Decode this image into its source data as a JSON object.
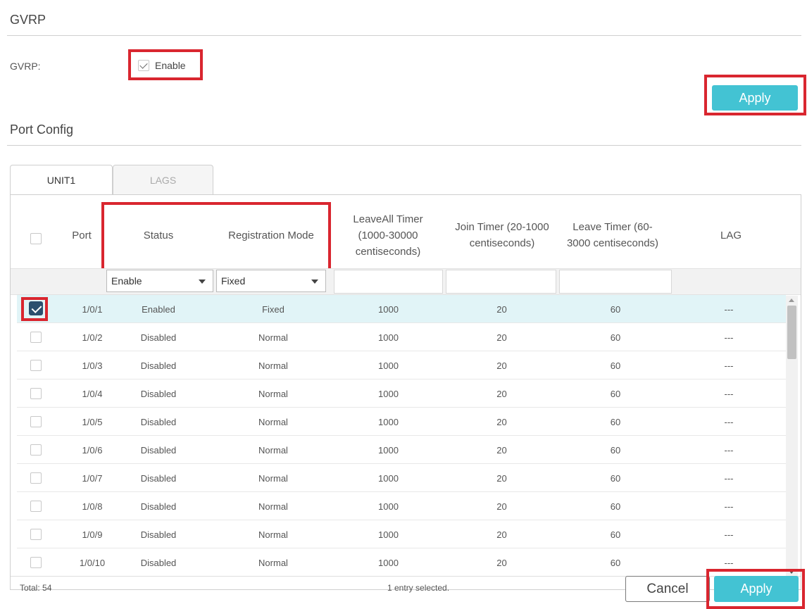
{
  "gvrp": {
    "section_title": "GVRP",
    "field_label": "GVRP:",
    "enable_label": "Enable",
    "enabled": true,
    "apply_label": "Apply"
  },
  "port_config": {
    "section_title": "Port Config",
    "tabs": [
      {
        "label": "UNIT1",
        "active": true
      },
      {
        "label": "LAGS",
        "active": false
      }
    ],
    "headers": {
      "port": "Port",
      "status": "Status",
      "registration_mode": "Registration Mode",
      "leaveall_timer": "LeaveAll Timer (1000-30000 centiseconds)",
      "join_timer": "Join Timer (20-1000 centiseconds)",
      "leave_timer": "Leave Timer (60-3000 centiseconds)",
      "lag": "LAG"
    },
    "filters": {
      "status_value": "Enable",
      "registration_mode_value": "Fixed"
    },
    "rows": [
      {
        "port": "1/0/1",
        "status": "Enabled",
        "mode": "Fixed",
        "leaveall": "1000",
        "join": "20",
        "leave": "60",
        "lag": "---",
        "selected": true
      },
      {
        "port": "1/0/2",
        "status": "Disabled",
        "mode": "Normal",
        "leaveall": "1000",
        "join": "20",
        "leave": "60",
        "lag": "---",
        "selected": false
      },
      {
        "port": "1/0/3",
        "status": "Disabled",
        "mode": "Normal",
        "leaveall": "1000",
        "join": "20",
        "leave": "60",
        "lag": "---",
        "selected": false
      },
      {
        "port": "1/0/4",
        "status": "Disabled",
        "mode": "Normal",
        "leaveall": "1000",
        "join": "20",
        "leave": "60",
        "lag": "---",
        "selected": false
      },
      {
        "port": "1/0/5",
        "status": "Disabled",
        "mode": "Normal",
        "leaveall": "1000",
        "join": "20",
        "leave": "60",
        "lag": "---",
        "selected": false
      },
      {
        "port": "1/0/6",
        "status": "Disabled",
        "mode": "Normal",
        "leaveall": "1000",
        "join": "20",
        "leave": "60",
        "lag": "---",
        "selected": false
      },
      {
        "port": "1/0/7",
        "status": "Disabled",
        "mode": "Normal",
        "leaveall": "1000",
        "join": "20",
        "leave": "60",
        "lag": "---",
        "selected": false
      },
      {
        "port": "1/0/8",
        "status": "Disabled",
        "mode": "Normal",
        "leaveall": "1000",
        "join": "20",
        "leave": "60",
        "lag": "---",
        "selected": false
      },
      {
        "port": "1/0/9",
        "status": "Disabled",
        "mode": "Normal",
        "leaveall": "1000",
        "join": "20",
        "leave": "60",
        "lag": "---",
        "selected": false
      },
      {
        "port": "1/0/10",
        "status": "Disabled",
        "mode": "Normal",
        "leaveall": "1000",
        "join": "20",
        "leave": "60",
        "lag": "---",
        "selected": false
      }
    ],
    "footer": {
      "total": "Total: 54",
      "selection": "1 entry selected.",
      "cancel_label": "Cancel",
      "apply_label": "Apply"
    }
  },
  "colors": {
    "accent": "#43c3d3",
    "highlight": "#d9262f",
    "selected_row": "#e1f4f7",
    "checkbox_checked": "#2b4f6e"
  }
}
